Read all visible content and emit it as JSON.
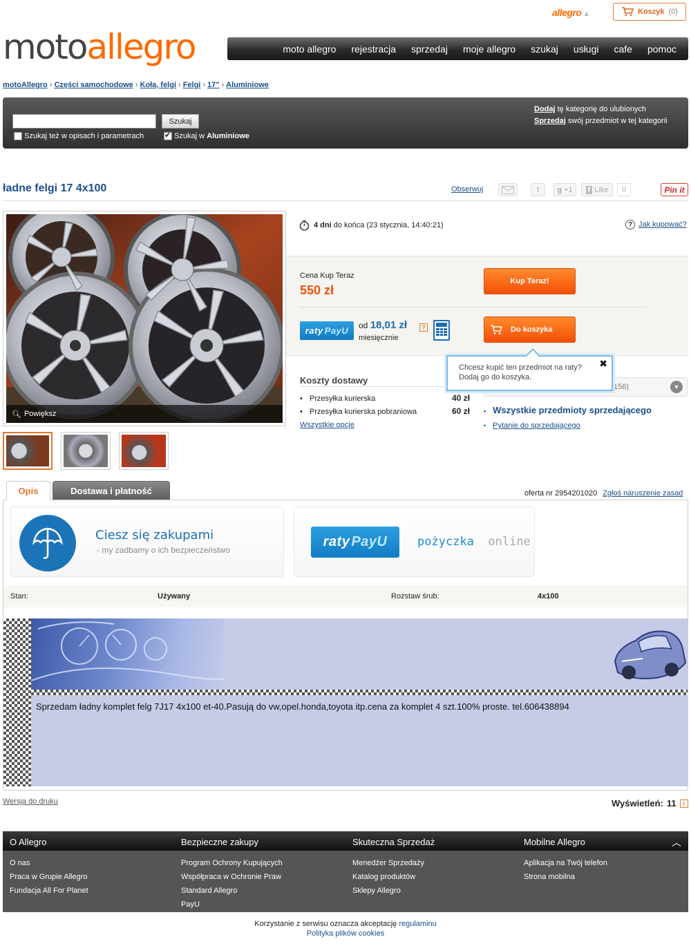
{
  "topbar": {
    "allegro_link": "allegro",
    "cart_label": "Koszyk",
    "cart_count": "(0)"
  },
  "logo": {
    "moto": "moto",
    "allegro": "allegro"
  },
  "nav": [
    "moto allegro",
    "rejestracja",
    "sprzedaj",
    "moje allegro",
    "szukaj",
    "usługi",
    "cafe",
    "pomoc"
  ],
  "breadcrumb": [
    "motoAllegro",
    "Części samochodowe",
    "Koła, felgi",
    "Felgi",
    "17\"",
    "Aluminiowe"
  ],
  "search": {
    "value": "",
    "button": "Szukaj",
    "opt_desc": "Szukaj też w opisach i parametrach",
    "opt_desc_checked": false,
    "opt_cat_prefix": "Szukaj w",
    "opt_cat_name": "Aluminiowe",
    "opt_cat_checked": true,
    "fav_link": "Dodaj",
    "fav_text": "tę kategorię do ulubionych",
    "sell_link": "Sprzedaj",
    "sell_text": "swój przedmiot w tej kategorii"
  },
  "listing": {
    "title": "ładne felgi 17 4x100",
    "observe": "Obserwuj",
    "gplus": "+1",
    "fb_like": "Like",
    "fb_count": "0",
    "pinit": "Pin it",
    "zoom": "Powiększ",
    "time_bold": "4 dni",
    "time_rest": "do końca (23 stycznia, 14:40:21)",
    "how_to_buy": "Jak kupować?",
    "price_label": "Cena Kup Teraz",
    "price": "550 zł",
    "buy_now": "Kup Teraz!",
    "add_to_cart": "Do koszyka",
    "installment_od": "od",
    "installment_amount": "18,01 zł",
    "installment_monthly": "miesięcznie",
    "raty_badge_a": "raty",
    "raty_badge_b": "PayU",
    "tooltip_line1": "Chcesz kupić ten przedmiot na raty?",
    "tooltip_line2": "Dodaj go do koszyka.",
    "seller_box_text": "156)"
  },
  "shipping": {
    "title": "Koszty dostawy",
    "rows": [
      {
        "name": "Przesyłka kurierska",
        "price": "40 zł"
      },
      {
        "name": "Przesyłka kurierska pobraniowa",
        "price": "60 zł"
      }
    ],
    "all_options": "Wszystkie opcje"
  },
  "seller": {
    "all_items": "Wszystkie przedmioty sprzedającego",
    "ask": "Pytanie do sprzedającego"
  },
  "tabs": [
    "Opis",
    "Dostawa i płatność"
  ],
  "offer": {
    "number": "oferta nr 2954201020",
    "report": "Zgłoś naruszenie zasad"
  },
  "promo": {
    "headline": "Ciesz się zakupami",
    "sub": "-  my zadbamy o ich bezpieczeństwo",
    "loan_a": "pożyczka",
    "loan_b": "online"
  },
  "params": {
    "stan_label": "Stan:",
    "stan_value": "Używany",
    "rozstaw_label": "Rozstaw śrub:",
    "rozstaw_value": "4x100"
  },
  "description": "Sprzedam ładny komplet felg 7J17 4x100 et-40.Pasują do vw,opel.honda,toyota itp.cena za komplet 4 szt.100% proste. tel.606438894",
  "bottom": {
    "print": "Wersja do druku",
    "views_label": "Wyświetleń:",
    "views_count": "11"
  },
  "footer": {
    "cols": [
      {
        "title": "O Allegro",
        "items": [
          "O nas",
          "Praca w Grupie Allegro",
          "Fundacja All For Planet"
        ]
      },
      {
        "title": "Bezpieczne zakupy",
        "items": [
          "Program Ochrony Kupujących",
          "Współpraca w Ochronie Praw",
          "Standard Allegro",
          "PayU"
        ]
      },
      {
        "title": "Skuteczna Sprzedaż",
        "items": [
          "Menedżer Sprzedaży",
          "Katalog produktów",
          "Sklepy Allegro"
        ]
      },
      {
        "title": "Mobilne Allegro",
        "items": [
          "Aplikacja na Twój telefon",
          "Strona mobilna"
        ]
      }
    ],
    "legal_prefix": "Korzystanie z serwisu oznacza akceptację",
    "legal_link": "regulaminu",
    "cookies": "Polityka plików cookies"
  },
  "colors": {
    "accent": "#ff6a00",
    "link": "#1a4f8a",
    "price": "#e8540f",
    "button_orange": "#f24f06"
  }
}
